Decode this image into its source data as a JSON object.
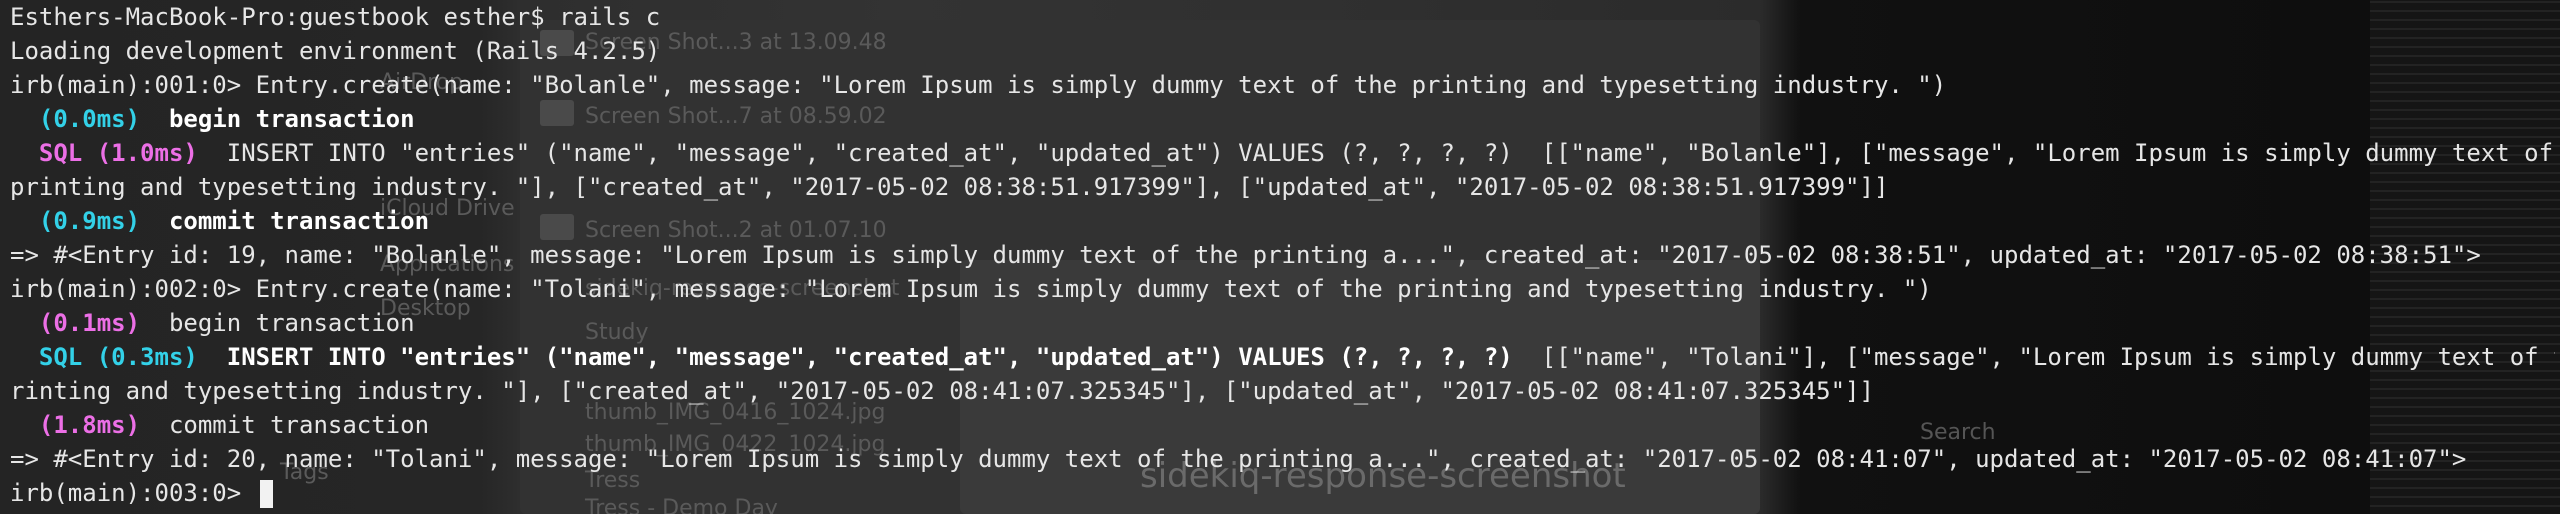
{
  "terminal": {
    "lines": [
      {
        "parts": [
          {
            "text": "Esthers-MacBook-Pro:guestbook esther$ rails c"
          }
        ]
      },
      {
        "parts": [
          {
            "text": "Loading development environment (Rails 4.2.5)"
          }
        ]
      },
      {
        "parts": [
          {
            "text": "irb(main):001:0> Entry.create(name: \"Bolanle\", message: \"Lorem Ipsum is simply dummy text of the printing and typesetting industry. \")"
          }
        ]
      },
      {
        "parts": [
          {
            "text": "  (0.0ms)",
            "style": "cyan"
          },
          {
            "text": "  begin transaction",
            "style": "boldw"
          }
        ]
      },
      {
        "parts": [
          {
            "text": "  SQL (1.0ms)",
            "style": "magenta"
          },
          {
            "text": "  INSERT INTO \"entries\" (\"name\", \"message\", \"created_at\", \"updated_at\") VALUES (?, ?, ?, ?)  [[\"name\", \"Bolanle\"], [\"message\", \"Lorem Ipsum is simply dummy text of the"
          }
        ]
      },
      {
        "parts": [
          {
            "text": "printing and typesetting industry. \"], [\"created_at\", \"2017-05-02 08:38:51.917399\"], [\"updated_at\", \"2017-05-02 08:38:51.917399\"]]"
          }
        ]
      },
      {
        "parts": [
          {
            "text": "  (0.9ms)",
            "style": "cyan"
          },
          {
            "text": "  commit transaction",
            "style": "boldw"
          }
        ]
      },
      {
        "parts": [
          {
            "text": "=> #<Entry id: 19, name: \"Bolanle\", message: \"Lorem Ipsum is simply dummy text of the printing a...\", created_at: \"2017-05-02 08:38:51\", updated_at: \"2017-05-02 08:38:51\">"
          }
        ]
      },
      {
        "parts": [
          {
            "text": "irb(main):002:0> Entry.create(name: \"Tolani\", message: \"Lorem Ipsum is simply dummy text of the printing and typesetting industry. \")"
          }
        ]
      },
      {
        "parts": [
          {
            "text": "  (0.1ms)",
            "style": "magenta"
          },
          {
            "text": "  begin transaction"
          }
        ]
      },
      {
        "parts": [
          {
            "text": "  SQL (0.3ms)",
            "style": "cyan"
          },
          {
            "text": "  INSERT INTO \"entries\" (\"name\", \"message\", \"created_at\", \"updated_at\") VALUES (?, ?, ?, ?)",
            "style": "boldw"
          },
          {
            "text": "  [[\"name\", \"Tolani\"], [\"message\", \"Lorem Ipsum is simply dummy text of the p"
          }
        ]
      },
      {
        "parts": [
          {
            "text": "rinting and typesetting industry. \"], [\"created_at\", \"2017-05-02 08:41:07.325345\"], [\"updated_at\", \"2017-05-02 08:41:07.325345\"]]"
          }
        ]
      },
      {
        "parts": [
          {
            "text": "  (1.8ms)",
            "style": "magenta"
          },
          {
            "text": "  commit transaction"
          }
        ]
      },
      {
        "parts": [
          {
            "text": "=> #<Entry id: 20, name: \"Tolani\", message: \"Lorem Ipsum is simply dummy text of the printing a...\", created_at: \"2017-05-02 08:41:07\", updated_at: \"2017-05-02 08:41:07\">"
          }
        ]
      },
      {
        "parts": [
          {
            "text": "irb(main):003:0> "
          }
        ],
        "cursor": true
      }
    ]
  },
  "background": {
    "finder_items": [
      "Screen Shot...3 at 13.09.48",
      "Screen Shot...7 at 08.59.02",
      "AirDrop",
      "iCloud Drive",
      "Screen Shot...2 at 01.07.10",
      "Applications",
      "Desktop",
      "sidekiq-response-screenshot",
      "Study",
      "thumb_IMG_0416_1024.jpg",
      "thumb_IMG_0422_1024.jpg",
      "Tags",
      "Tress",
      "Tress - Demo Day"
    ],
    "window_title": "sidekiq-response-screenshot",
    "search_placeholder": "Search"
  },
  "colors": {
    "background": "#1b1b1b",
    "text": "#e6e6e6",
    "cyan": "#33d1e8",
    "magenta": "#ec6fe6",
    "bold": "#ffffff"
  }
}
